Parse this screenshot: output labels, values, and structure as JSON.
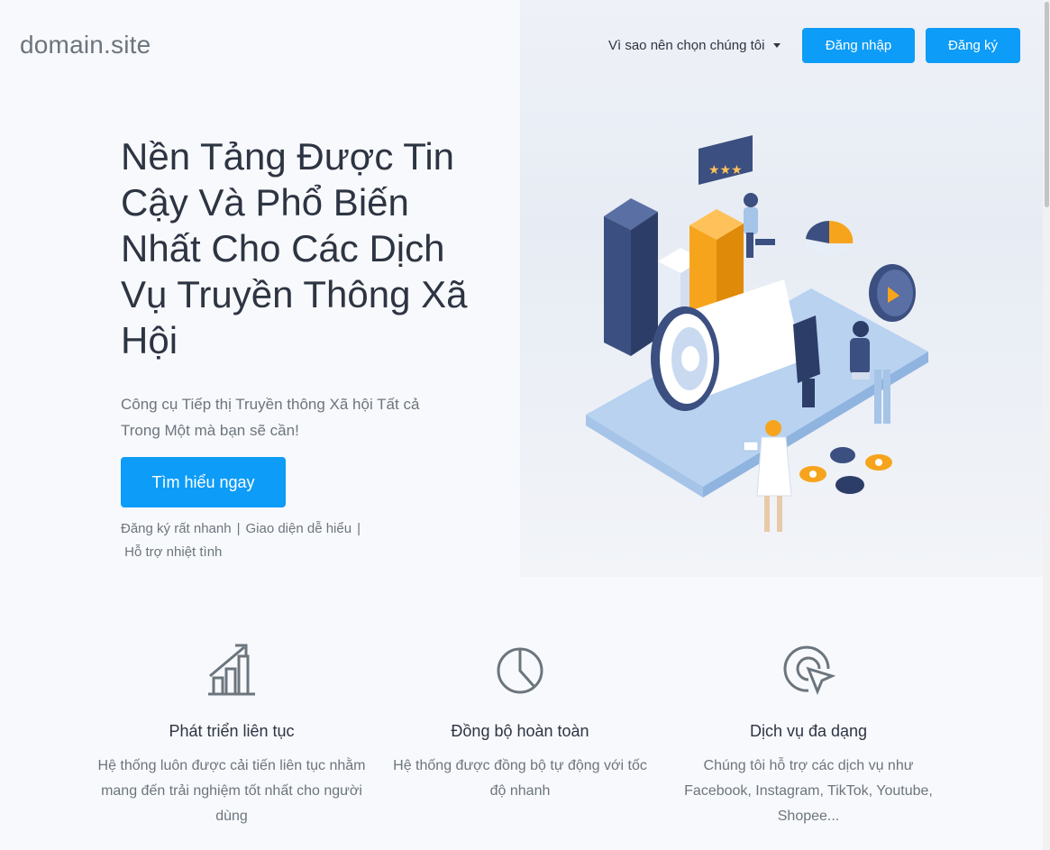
{
  "brand": "domain.site",
  "nav": {
    "dropdown_label": "Vì sao nên chọn chúng tôi",
    "login_label": "Đăng nhập",
    "register_label": "Đăng ký"
  },
  "hero": {
    "title": "Nền Tảng Được Tin Cậy Và Phổ Biến Nhất Cho Các Dịch Vụ Truyền Thông Xã Hội",
    "subtitle": "Công cụ Tiếp thị Truyền thông Xã hội Tất cả Trong Một mà bạn sẽ cần!",
    "cta_label": "Tìm hiểu ngay",
    "perks": [
      "Đăng ký rất nhanh",
      "Giao diện dễ hiểu",
      "Hỗ trợ nhiệt tình"
    ]
  },
  "features": [
    {
      "icon": "growth-chart-icon",
      "title": "Phát triển liên tục",
      "text": "Hệ thống luôn được cải tiến liên tục nhằm mang đến trải nghiệm tốt nhất cho người dùng"
    },
    {
      "icon": "pie-chart-icon",
      "title": "Đồng bộ hoàn toàn",
      "text": "Hệ thống được đồng bộ tự động với tốc độ nhanh"
    },
    {
      "icon": "cursor-target-icon",
      "title": "Dịch vụ đa dạng",
      "text": "Chúng tôi hỗ trợ các dịch vụ như Facebook, Instagram, TikTok, Youtube, Shopee..."
    }
  ],
  "colors": {
    "accent": "#0d9cf7",
    "text_dark": "#2d3442",
    "text_muted": "#6c757d",
    "illustration_orange": "#f7a41d",
    "illustration_navy": "#3b4f80"
  }
}
